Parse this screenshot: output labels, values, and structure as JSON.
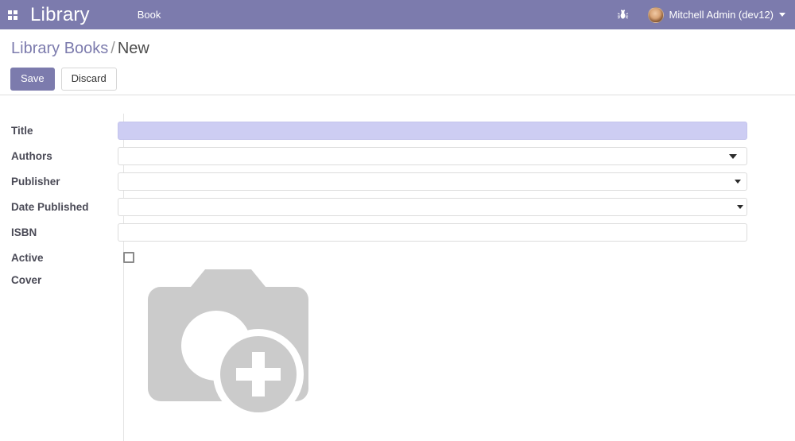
{
  "navbar": {
    "apps_icon": "grid-apps-icon",
    "brand": "Library",
    "menu_items": [
      {
        "label": "Book"
      }
    ],
    "debug_icon": "bug-icon",
    "user": {
      "name": "Mitchell Admin (dev12)",
      "avatar": "user-avatar",
      "caret": "chevron-down-icon"
    },
    "background_color": "#7c7bad"
  },
  "control_panel": {
    "breadcrumb": {
      "parent": "Library Books",
      "separator": "/",
      "current": "New"
    },
    "save_label": "Save",
    "discard_label": "Discard",
    "save_color": "#7c7bad"
  },
  "form": {
    "fields": [
      {
        "label": "Title",
        "type": "text",
        "value": "",
        "placeholder": "",
        "required_highlight": true,
        "highlight_color": "#cdcdf3"
      },
      {
        "label": "Authors",
        "type": "many2many",
        "value": "",
        "placeholder": "",
        "caret": "dropdown-caret-icon"
      },
      {
        "label": "Publisher",
        "type": "many2one",
        "value": "",
        "placeholder": "",
        "caret": "dropdown-caret-icon"
      },
      {
        "label": "Date Published",
        "type": "date",
        "value": "",
        "placeholder": "",
        "caret": "dropdown-caret-icon"
      },
      {
        "label": "ISBN",
        "type": "text",
        "value": "",
        "placeholder": ""
      },
      {
        "label": "Active",
        "type": "checkbox",
        "checked": false
      },
      {
        "label": "Cover",
        "type": "image",
        "placeholder_icon": "camera-placeholder-icon",
        "placeholder_color": "#cbcbcb"
      }
    ]
  }
}
